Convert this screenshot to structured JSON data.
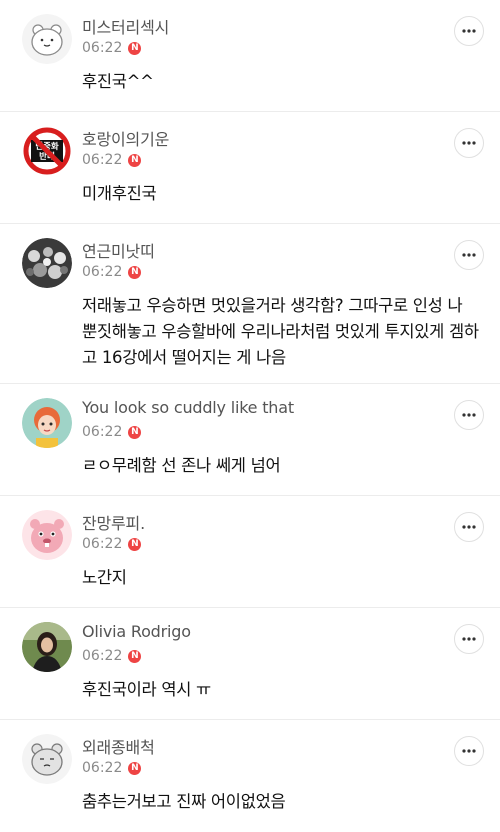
{
  "comments": [
    {
      "nickname": "미스터리섹시",
      "time": "06:22",
      "badge": "N",
      "text": "후진국^^",
      "avatar": "white-bear-avatar"
    },
    {
      "nickname": "호랑이의기운",
      "time": "06:22",
      "badge": "N",
      "text": "미개후진국",
      "avatar": "anti-sign-avatar",
      "avatar_text": "민중화 반대",
      "avatar_color": "#d81e1e"
    },
    {
      "nickname": "연근미낫띠",
      "time": "06:22",
      "badge": "N",
      "text": "저래놓고 우승하면 멋있을거라 생각함? 그따구로 인성 나 뿐짓해놓고 우승할바에 우리나라처럼 멋있게 투지있게 겜하고 16강에서 떨어지는 게 나음",
      "avatar": "group-photo-avatar"
    },
    {
      "nickname": "You look so cuddly like that",
      "time": "06:22",
      "badge": "N",
      "text": "ㄹㅇ무례함 선 존나 쎄게 넘어",
      "avatar": "cartoon-girl-avatar"
    },
    {
      "nickname": "잔망루피.",
      "time": "06:22",
      "badge": "N",
      "text": "노간지",
      "avatar": "pink-beaver-avatar",
      "avatar_color": "#f2a9b6"
    },
    {
      "nickname": "Olivia Rodrigo",
      "time": "06:22",
      "badge": "N",
      "text": "후진국이라 역시 ㅠ",
      "avatar": "woman-photo-avatar"
    },
    {
      "nickname": "외래종배척",
      "time": "06:22",
      "badge": "N",
      "text": "춤추는거보고 진짜 어이없었음",
      "avatar": "gray-bear-avatar"
    }
  ],
  "icons": {
    "more": "more-options-icon",
    "new_badge": "new-badge"
  },
  "colors": {
    "badge": "#ee4444",
    "divider": "#ececec",
    "nickname": "#555555",
    "time": "#8a8a8a"
  }
}
